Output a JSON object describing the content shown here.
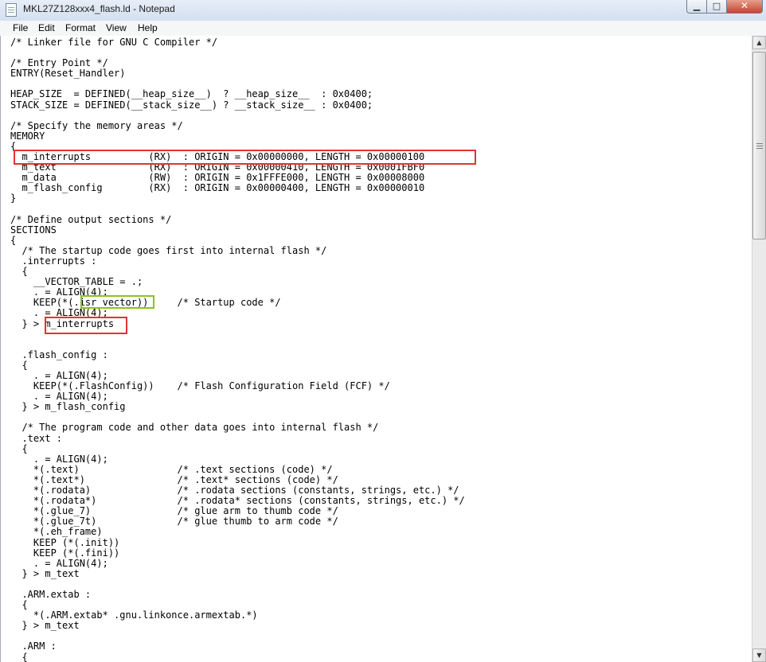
{
  "window": {
    "title": "MKL27Z128xxx4_flash.ld - Notepad"
  },
  "controls": {
    "minimize": "▁",
    "maximize": "□",
    "close": "✕"
  },
  "menu": [
    "File",
    "Edit",
    "Format",
    "View",
    "Help"
  ],
  "editor": {
    "lines": [
      "/* Linker file for GNU C Compiler */",
      "",
      "/* Entry Point */",
      "ENTRY(Reset_Handler)",
      "",
      "HEAP_SIZE  = DEFINED(__heap_size__)  ? __heap_size__  : 0x0400;",
      "STACK_SIZE = DEFINED(__stack_size__) ? __stack_size__ : 0x0400;",
      "",
      "/* Specify the memory areas */",
      "MEMORY",
      "{",
      "  m_interrupts          (RX)  : ORIGIN = 0x00000000, LENGTH = 0x00000100",
      "  m_text                (RX)  : ORIGIN = 0x00000410, LENGTH = 0x0001FBF0",
      "  m_data                (RW)  : ORIGIN = 0x1FFFE000, LENGTH = 0x00008000",
      "  m_flash_config        (RX)  : ORIGIN = 0x00000400, LENGTH = 0x00000010",
      "}",
      "",
      "/* Define output sections */",
      "SECTIONS",
      "{",
      "  /* The startup code goes first into internal flash */",
      "  .interrupts :",
      "  {",
      "    __VECTOR_TABLE = .;",
      "    . = ALIGN(4);",
      "    KEEP(*(.isr_vector))     /* Startup code */",
      "    . = ALIGN(4);",
      "  } > m_interrupts",
      "",
      "",
      "  .flash_config :",
      "  {",
      "    . = ALIGN(4);",
      "    KEEP(*(.FlashConfig))    /* Flash Configuration Field (FCF) */",
      "    . = ALIGN(4);",
      "  } > m_flash_config",
      "",
      "  /* The program code and other data goes into internal flash */",
      "  .text :",
      "  {",
      "    . = ALIGN(4);",
      "    *(.text)                 /* .text sections (code) */",
      "    *(.text*)                /* .text* sections (code) */",
      "    *(.rodata)               /* .rodata sections (constants, strings, etc.) */",
      "    *(.rodata*)              /* .rodata* sections (constants, strings, etc.) */",
      "    *(.glue_7)               /* glue arm to thumb code */",
      "    *(.glue_7t)              /* glue thumb to arm code */",
      "    *(.eh_frame)",
      "    KEEP (*(.init))",
      "    KEEP (*(.fini))",
      "    . = ALIGN(4);",
      "  } > m_text",
      "",
      "  .ARM.extab :",
      "  {",
      "    *(.ARM.extab* .gnu.linkonce.armextab.*)",
      "  } > m_text",
      "",
      "  .ARM :",
      "  {"
    ]
  },
  "colors": {
    "highlight_red": "#e03434",
    "highlight_green": "#8dc21f"
  }
}
